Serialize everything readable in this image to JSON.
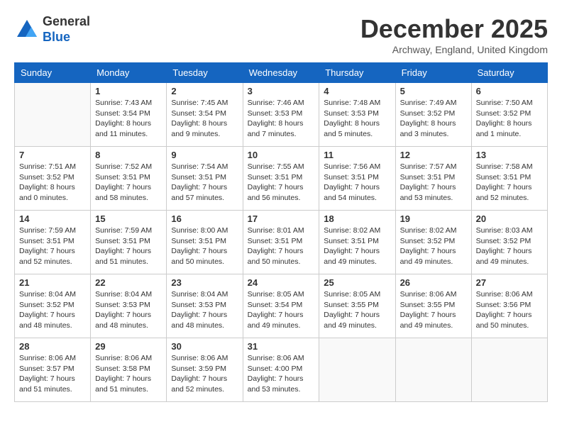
{
  "header": {
    "logo_line1": "General",
    "logo_line2": "Blue",
    "month": "December 2025",
    "location": "Archway, England, United Kingdom"
  },
  "days_of_week": [
    "Sunday",
    "Monday",
    "Tuesday",
    "Wednesday",
    "Thursday",
    "Friday",
    "Saturday"
  ],
  "weeks": [
    [
      {
        "day": "",
        "info": ""
      },
      {
        "day": "1",
        "info": "Sunrise: 7:43 AM\nSunset: 3:54 PM\nDaylight: 8 hours\nand 11 minutes."
      },
      {
        "day": "2",
        "info": "Sunrise: 7:45 AM\nSunset: 3:54 PM\nDaylight: 8 hours\nand 9 minutes."
      },
      {
        "day": "3",
        "info": "Sunrise: 7:46 AM\nSunset: 3:53 PM\nDaylight: 8 hours\nand 7 minutes."
      },
      {
        "day": "4",
        "info": "Sunrise: 7:48 AM\nSunset: 3:53 PM\nDaylight: 8 hours\nand 5 minutes."
      },
      {
        "day": "5",
        "info": "Sunrise: 7:49 AM\nSunset: 3:52 PM\nDaylight: 8 hours\nand 3 minutes."
      },
      {
        "day": "6",
        "info": "Sunrise: 7:50 AM\nSunset: 3:52 PM\nDaylight: 8 hours\nand 1 minute."
      }
    ],
    [
      {
        "day": "7",
        "info": "Sunrise: 7:51 AM\nSunset: 3:52 PM\nDaylight: 8 hours\nand 0 minutes."
      },
      {
        "day": "8",
        "info": "Sunrise: 7:52 AM\nSunset: 3:51 PM\nDaylight: 7 hours\nand 58 minutes."
      },
      {
        "day": "9",
        "info": "Sunrise: 7:54 AM\nSunset: 3:51 PM\nDaylight: 7 hours\nand 57 minutes."
      },
      {
        "day": "10",
        "info": "Sunrise: 7:55 AM\nSunset: 3:51 PM\nDaylight: 7 hours\nand 56 minutes."
      },
      {
        "day": "11",
        "info": "Sunrise: 7:56 AM\nSunset: 3:51 PM\nDaylight: 7 hours\nand 54 minutes."
      },
      {
        "day": "12",
        "info": "Sunrise: 7:57 AM\nSunset: 3:51 PM\nDaylight: 7 hours\nand 53 minutes."
      },
      {
        "day": "13",
        "info": "Sunrise: 7:58 AM\nSunset: 3:51 PM\nDaylight: 7 hours\nand 52 minutes."
      }
    ],
    [
      {
        "day": "14",
        "info": "Sunrise: 7:59 AM\nSunset: 3:51 PM\nDaylight: 7 hours\nand 52 minutes."
      },
      {
        "day": "15",
        "info": "Sunrise: 7:59 AM\nSunset: 3:51 PM\nDaylight: 7 hours\nand 51 minutes."
      },
      {
        "day": "16",
        "info": "Sunrise: 8:00 AM\nSunset: 3:51 PM\nDaylight: 7 hours\nand 50 minutes."
      },
      {
        "day": "17",
        "info": "Sunrise: 8:01 AM\nSunset: 3:51 PM\nDaylight: 7 hours\nand 50 minutes."
      },
      {
        "day": "18",
        "info": "Sunrise: 8:02 AM\nSunset: 3:51 PM\nDaylight: 7 hours\nand 49 minutes."
      },
      {
        "day": "19",
        "info": "Sunrise: 8:02 AM\nSunset: 3:52 PM\nDaylight: 7 hours\nand 49 minutes."
      },
      {
        "day": "20",
        "info": "Sunrise: 8:03 AM\nSunset: 3:52 PM\nDaylight: 7 hours\nand 49 minutes."
      }
    ],
    [
      {
        "day": "21",
        "info": "Sunrise: 8:04 AM\nSunset: 3:52 PM\nDaylight: 7 hours\nand 48 minutes."
      },
      {
        "day": "22",
        "info": "Sunrise: 8:04 AM\nSunset: 3:53 PM\nDaylight: 7 hours\nand 48 minutes."
      },
      {
        "day": "23",
        "info": "Sunrise: 8:04 AM\nSunset: 3:53 PM\nDaylight: 7 hours\nand 48 minutes."
      },
      {
        "day": "24",
        "info": "Sunrise: 8:05 AM\nSunset: 3:54 PM\nDaylight: 7 hours\nand 49 minutes."
      },
      {
        "day": "25",
        "info": "Sunrise: 8:05 AM\nSunset: 3:55 PM\nDaylight: 7 hours\nand 49 minutes."
      },
      {
        "day": "26",
        "info": "Sunrise: 8:06 AM\nSunset: 3:55 PM\nDaylight: 7 hours\nand 49 minutes."
      },
      {
        "day": "27",
        "info": "Sunrise: 8:06 AM\nSunset: 3:56 PM\nDaylight: 7 hours\nand 50 minutes."
      }
    ],
    [
      {
        "day": "28",
        "info": "Sunrise: 8:06 AM\nSunset: 3:57 PM\nDaylight: 7 hours\nand 51 minutes."
      },
      {
        "day": "29",
        "info": "Sunrise: 8:06 AM\nSunset: 3:58 PM\nDaylight: 7 hours\nand 51 minutes."
      },
      {
        "day": "30",
        "info": "Sunrise: 8:06 AM\nSunset: 3:59 PM\nDaylight: 7 hours\nand 52 minutes."
      },
      {
        "day": "31",
        "info": "Sunrise: 8:06 AM\nSunset: 4:00 PM\nDaylight: 7 hours\nand 53 minutes."
      },
      {
        "day": "",
        "info": ""
      },
      {
        "day": "",
        "info": ""
      },
      {
        "day": "",
        "info": ""
      }
    ]
  ]
}
